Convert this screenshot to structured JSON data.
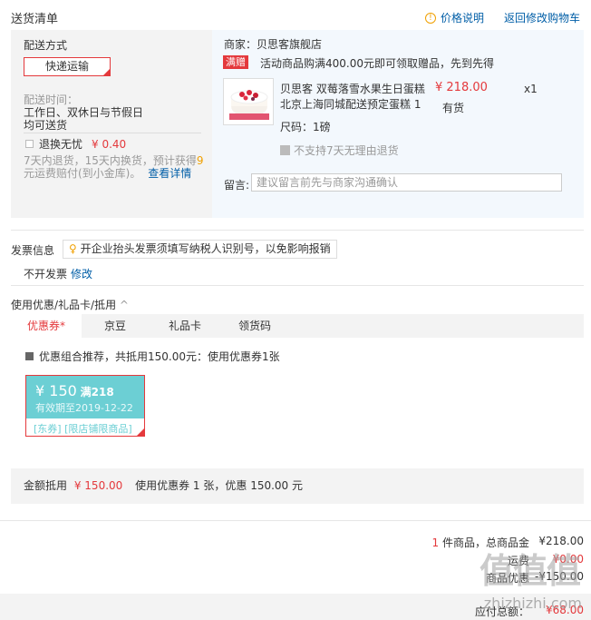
{
  "header": {
    "title": "送货清单",
    "price_note": "价格说明",
    "back_to_cart": "返回修改购物车"
  },
  "shipping": {
    "method_label": "配送方式",
    "method_value": "快递运输",
    "time_label": "配送时间：",
    "time_value_1": "工作日、双休日与节假日",
    "time_value_2": "均可送货",
    "return_label": "退换无忧",
    "return_price": "¥ 0.40",
    "return_desc_1": "7天内退货，15天内换货，预计获得",
    "return_desc_num": "9",
    "return_desc_2": "元运费赔付(到小金库)。",
    "return_detail_link": "查看详情"
  },
  "shop": {
    "name": "商家：贝思客旗舰店",
    "promo_badge": "满赠",
    "promo_text": "活动商品购满400.00元即可领取赠品，先到先得",
    "product_title_1": "贝思客 双莓落雪水果生日蛋糕",
    "product_title_2": "北京上海同城配送预定蛋糕 1",
    "product_price": "¥ 218.00",
    "product_qty": "x1",
    "stock": "有货",
    "size": "尺码：1磅",
    "no_return": "不支持7天无理由退货",
    "message_label": "留言:",
    "message_placeholder": "建议留言前先与商家沟通确认"
  },
  "invoice": {
    "label": "发票信息",
    "tip": "开企业抬头发票须填写纳税人识别号，以免影响报销",
    "status": "不开发票",
    "edit": "修改"
  },
  "discount": {
    "section_title": "使用优惠/礼品卡/抵用",
    "tabs": [
      "优惠券",
      "京豆",
      "礼品卡",
      "领货码"
    ],
    "tab_star": "*",
    "combo_text": "优惠组合推荐，共抵用150.00元：使用优惠券1张",
    "coupon_amount": "¥ 150",
    "coupon_condition": "满218",
    "coupon_expiry": "有效期至2019-12-22",
    "coupon_tags": "[东券] [限店铺限商品]",
    "deduct_label": "金额抵用",
    "deduct_amount": "¥ 150.00",
    "deduct_desc": "使用优惠券 1 张，优惠 150.00 元"
  },
  "summary": {
    "item_count": "1",
    "item_text": "件商品，总商品金",
    "item_total": "¥218.00",
    "row2_label": "运费",
    "row2_value": "¥0.00",
    "row3_label": "商品优惠",
    "row3_value": "-¥150.00",
    "total_label": "应付总额：",
    "total_value": "¥68.00"
  },
  "watermark": {
    "big": "值值值",
    "small": "zhizhizhi.com"
  }
}
